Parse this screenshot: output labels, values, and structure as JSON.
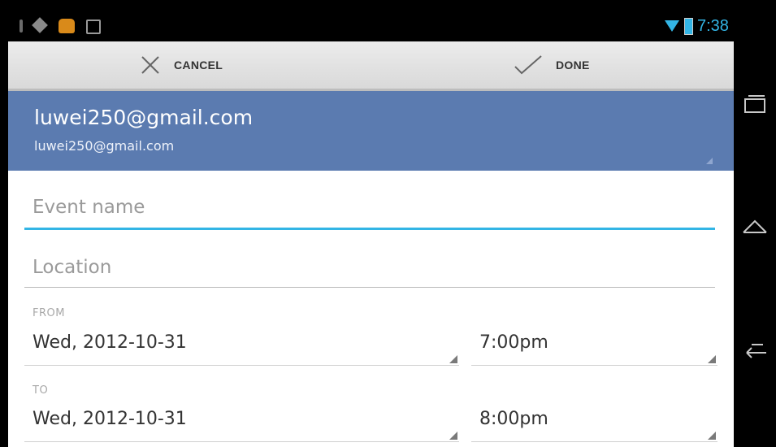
{
  "status_bar": {
    "clock": "7:38",
    "left_icons": [
      "usb-icon",
      "navigation-icon",
      "android-icon",
      "sd-card-icon"
    ],
    "right_icons": [
      "wifi-icon",
      "battery-icon"
    ],
    "accent_color": "#33b5e5"
  },
  "action_bar": {
    "cancel_label": "CANCEL",
    "done_label": "DONE"
  },
  "account": {
    "name": "luwei250@gmail.com",
    "email": "luwei250@gmail.com",
    "background_color": "#5b7bb0"
  },
  "form": {
    "event_name_placeholder": "Event name",
    "event_name_value": "",
    "location_placeholder": "Location",
    "location_value": "",
    "from_label": "FROM",
    "from_date": "Wed, 2012-10-31",
    "from_time": "7:00pm",
    "to_label": "TO",
    "to_date": "Wed, 2012-10-31",
    "to_time": "8:00pm"
  },
  "nav_bar": {
    "buttons": [
      "recents-icon",
      "home-icon",
      "back-icon"
    ]
  }
}
